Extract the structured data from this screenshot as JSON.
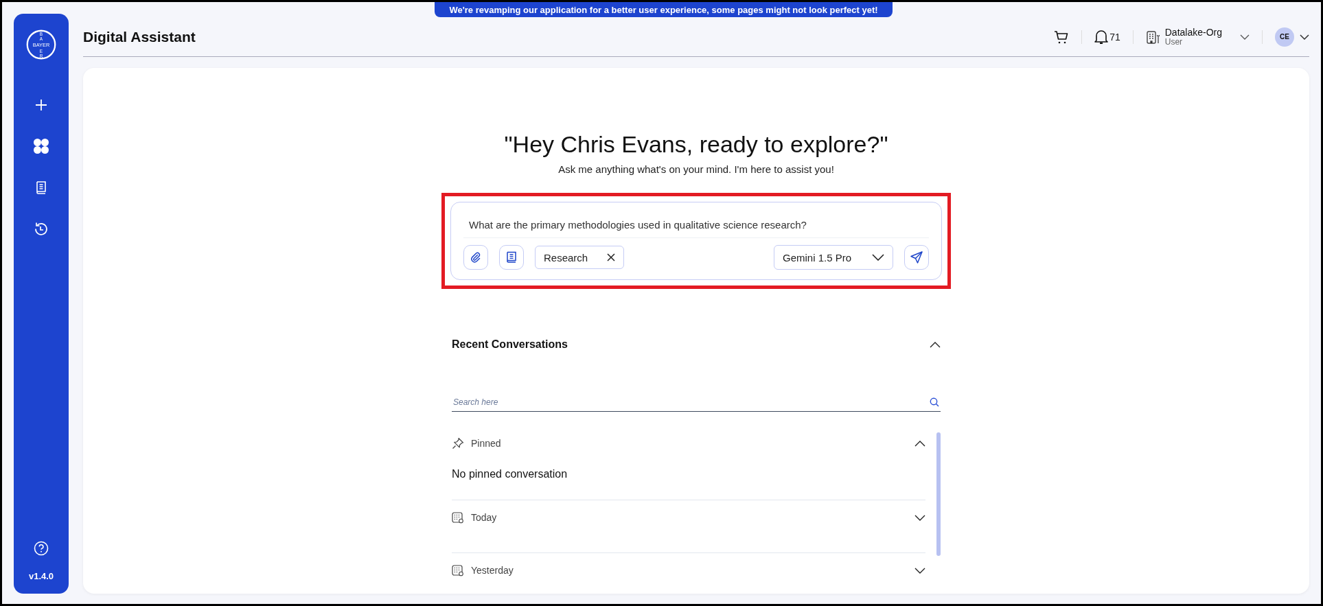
{
  "banner": "We're revamping our application for a better user experience, some pages might not look perfect yet!",
  "sidebar": {
    "logo_text": "BAYER",
    "logo_vertical_letters": [
      "B",
      "A",
      "E",
      "R"
    ],
    "items": [
      {
        "kind": "new"
      },
      {
        "kind": "apps"
      },
      {
        "kind": "library"
      },
      {
        "kind": "history"
      }
    ],
    "version": "v1.4.0"
  },
  "header": {
    "title": "Digital Assistant",
    "notification_count": "71",
    "org_name": "Datalake-Org",
    "role": "User",
    "avatar_initials": "CE"
  },
  "hero": {
    "heading": "\"Hey Chris Evans, ready to explore?\"",
    "subtitle": "Ask me anything what's on your mind. I'm here to assist you!"
  },
  "prompt": {
    "highlighted": true,
    "value": "What are the primary methodologies used in qualitative science research?",
    "tag": "Research",
    "model": "Gemini 1.5 Pro"
  },
  "recent": {
    "title": "Recent Conversations",
    "expanded": true,
    "search_placeholder": "Search here",
    "sections": [
      {
        "kind": "pinned",
        "label": "Pinned",
        "expanded": true,
        "empty_text": "No pinned conversation"
      },
      {
        "kind": "date",
        "label": "Today",
        "expanded": false
      },
      {
        "kind": "date",
        "label": "Yesterday",
        "expanded": false
      }
    ]
  }
}
